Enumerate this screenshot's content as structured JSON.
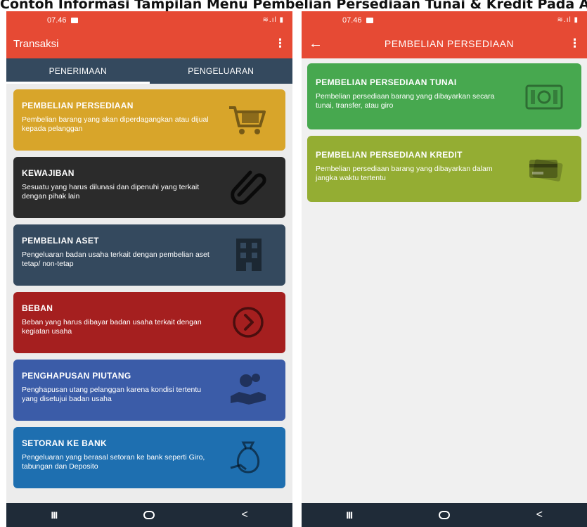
{
  "caption": "Contoh Informasi Tampilan Menu Pembelian Persediaan Tunai & Kredit Pada Aplikasi Akuntansi Transaksi",
  "status_bar": {
    "time": "07.46"
  },
  "left": {
    "title": "Transaksi",
    "tabs": [
      {
        "label": "PENERIMAAN",
        "active": true
      },
      {
        "label": "PENGELUARAN",
        "active": false
      }
    ],
    "cards": [
      {
        "title": "PEMBELIAN PERSEDIAAN",
        "desc": "Pembelian barang yang akan diperdagangkan atau dijual kepada pelanggan",
        "color": "#d8a52a",
        "icon": "shopping-cart-icon"
      },
      {
        "title": "KEWAJIBAN",
        "desc": "Sesuatu yang harus dilunasi dan dipenuhi yang terkait dengan pihak lain",
        "color": "#2b2b2b",
        "icon": "paperclip-icon"
      },
      {
        "title": "PEMBELIAN ASET",
        "desc": "Pengeluaran badan usaha terkait dengan pembelian aset tetap/ non-tetap",
        "color": "#34495e",
        "icon": "building-icon"
      },
      {
        "title": "BEBAN",
        "desc": "Beban yang harus dibayar badan usaha terkait dengan kegiatan usaha",
        "color": "#a51f1f",
        "icon": "arrow-circle-icon"
      },
      {
        "title": "PENGHAPUSAN PIUTANG",
        "desc": "Penghapusan utang pelanggan karena kondisi tertentu yang disetujui badan usaha",
        "color": "#3b5ca8",
        "icon": "hand-money-icon"
      },
      {
        "title": "SETORAN KE BANK",
        "desc": "Pengeluaran yang berasal setoran ke bank seperti Giro, tabungan dan Deposito",
        "color": "#1e6fb0",
        "icon": "money-bag-icon"
      }
    ]
  },
  "right": {
    "title": "PEMBELIAN PERSEDIAAN",
    "cards": [
      {
        "title": "PEMBELIAN PERSEDIAAN TUNAI",
        "desc": "Pembelian persediaan barang yang dibayarkan secara tunai, transfer, atau giro",
        "color": "#47a84f",
        "icon": "cash-icon"
      },
      {
        "title": "PEMBELIAN PERSEDIAAN KREDIT",
        "desc": "Pembelian persediaan barang yang dibayarkan dalam jangka waktu tertentu",
        "color": "#94ad33",
        "icon": "credit-card-icon"
      }
    ]
  },
  "nav": {
    "recents": "III",
    "back": "<"
  }
}
